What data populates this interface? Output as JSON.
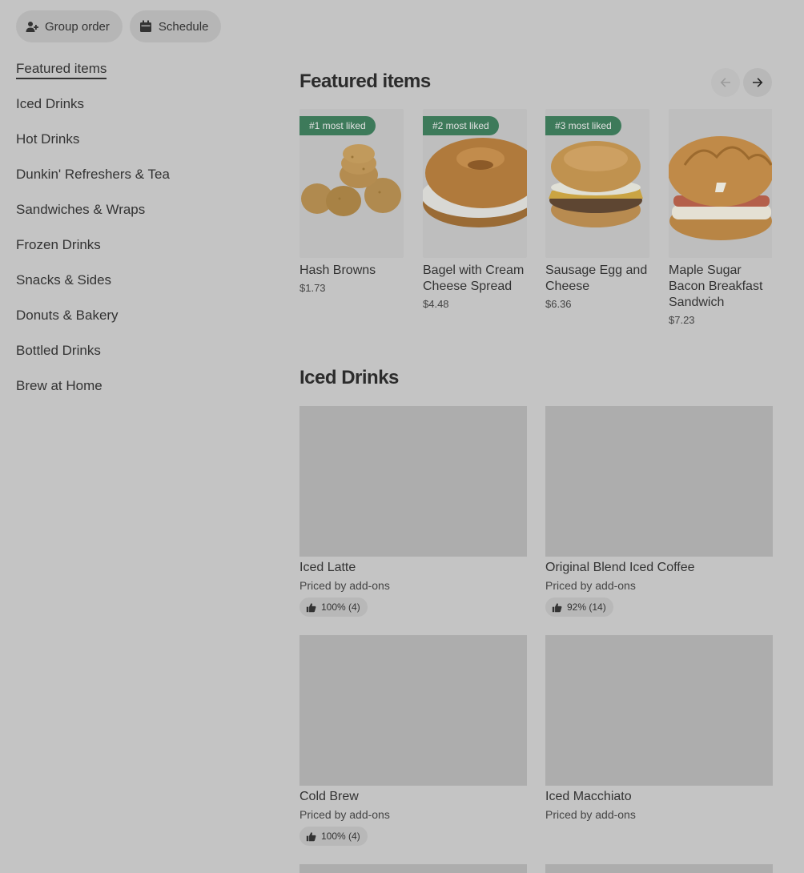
{
  "top_actions": {
    "group_order": "Group order",
    "schedule": "Schedule"
  },
  "sidebar": {
    "items": [
      {
        "label": "Featured items",
        "active": true
      },
      {
        "label": "Iced Drinks"
      },
      {
        "label": "Hot Drinks"
      },
      {
        "label": "Dunkin' Refreshers & Tea"
      },
      {
        "label": "Sandwiches & Wraps"
      },
      {
        "label": "Frozen Drinks"
      },
      {
        "label": "Snacks & Sides"
      },
      {
        "label": "Donuts & Bakery"
      },
      {
        "label": "Bottled Drinks"
      },
      {
        "label": "Brew at Home"
      }
    ]
  },
  "featured": {
    "title": "Featured items",
    "items": [
      {
        "badge": "#1 most liked",
        "name": "Hash Browns",
        "price": "$1.73"
      },
      {
        "badge": "#2 most liked",
        "name": "Bagel with Cream Cheese Spread",
        "price": "$4.48"
      },
      {
        "badge": "#3 most liked",
        "name": "Sausage Egg and Cheese",
        "price": "$6.36"
      },
      {
        "badge": "",
        "name": "Maple Sugar Bacon Breakfast Sandwich",
        "price": "$7.23"
      }
    ]
  },
  "iced_drinks": {
    "title": "Iced Drinks",
    "items": [
      {
        "name": "Iced Latte",
        "sub": "Priced by add-ons",
        "rating": "100% (4)"
      },
      {
        "name": "Original Blend Iced Coffee",
        "sub": "Priced by add-ons",
        "rating": "92% (14)"
      },
      {
        "name": "Cold Brew",
        "sub": "Priced by add-ons",
        "rating": "100% (4)"
      },
      {
        "name": "Iced Macchiato",
        "sub": "Priced by add-ons",
        "rating": ""
      }
    ]
  },
  "icons": {
    "group_order": "add-person-icon",
    "schedule": "calendar-icon",
    "prev": "arrow-left-icon",
    "next": "arrow-right-icon",
    "rating": "thumbs-up-icon"
  },
  "colors": {
    "badge": "#3d7a5a",
    "overlay_bg": "#c4c4c4"
  }
}
